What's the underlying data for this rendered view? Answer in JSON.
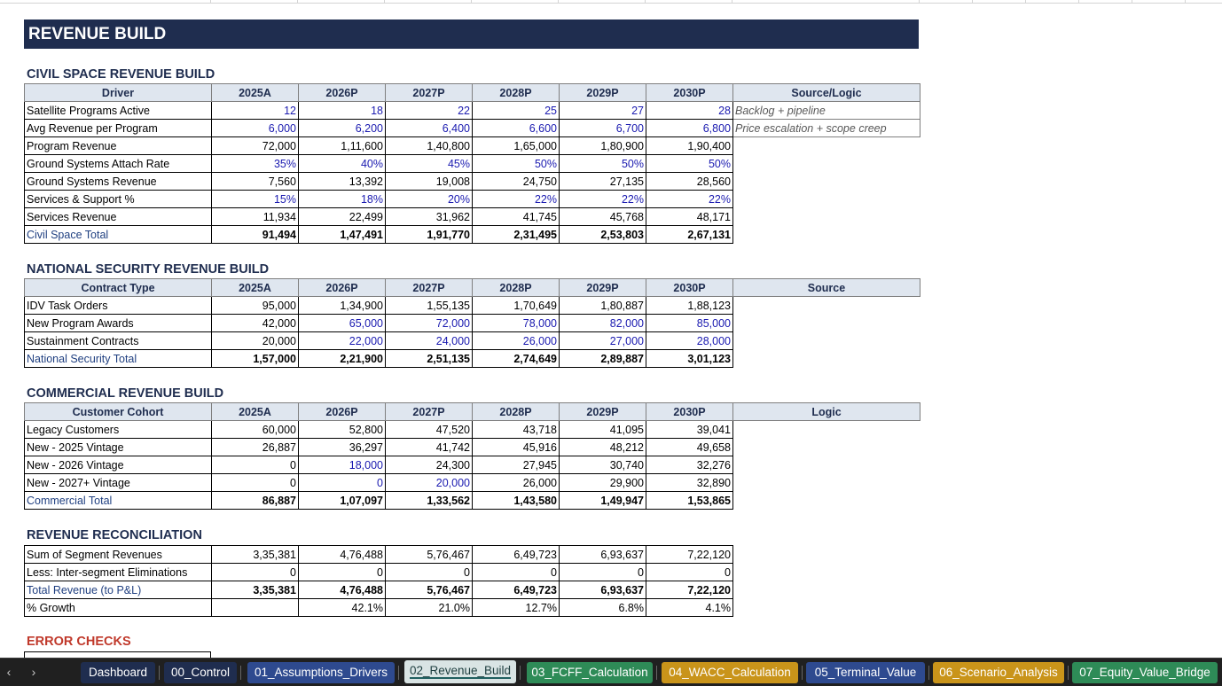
{
  "banner": "REVENUE BUILD",
  "civil": {
    "title": "CIVIL SPACE REVENUE BUILD",
    "headers": [
      "Driver",
      "2025A",
      "2026P",
      "2027P",
      "2028P",
      "2029P",
      "2030P",
      "Source/Logic"
    ],
    "rows": [
      {
        "label": "Satellite Programs Active",
        "values": [
          "12",
          "18",
          "22",
          "25",
          "27",
          "28"
        ],
        "note": "Backlog + pipeline",
        "blue": [
          1,
          1,
          1,
          1,
          1,
          1
        ]
      },
      {
        "label": "Avg Revenue per Program",
        "values": [
          "6,000",
          "6,200",
          "6,400",
          "6,600",
          "6,700",
          "6,800"
        ],
        "note": "Price escalation + scope creep",
        "blue": [
          1,
          1,
          1,
          1,
          1,
          1
        ]
      },
      {
        "label": "Program Revenue",
        "values": [
          "72,000",
          "1,11,600",
          "1,40,800",
          "1,65,000",
          "1,80,900",
          "1,90,400"
        ],
        "blue": [
          0,
          0,
          0,
          0,
          0,
          0
        ]
      },
      {
        "label": "Ground Systems Attach Rate",
        "values": [
          "35%",
          "40%",
          "45%",
          "50%",
          "50%",
          "50%"
        ],
        "blue": [
          1,
          1,
          1,
          1,
          1,
          1
        ]
      },
      {
        "label": "Ground Systems Revenue",
        "values": [
          "7,560",
          "13,392",
          "19,008",
          "24,750",
          "27,135",
          "28,560"
        ],
        "blue": [
          0,
          0,
          0,
          0,
          0,
          0
        ]
      },
      {
        "label": "Services & Support %",
        "values": [
          "15%",
          "18%",
          "20%",
          "22%",
          "22%",
          "22%"
        ],
        "blue": [
          1,
          1,
          1,
          1,
          1,
          1
        ]
      },
      {
        "label": "Services Revenue",
        "values": [
          "11,934",
          "22,499",
          "31,962",
          "41,745",
          "45,768",
          "48,171"
        ],
        "blue": [
          0,
          0,
          0,
          0,
          0,
          0
        ]
      },
      {
        "label": "Civil Space Total",
        "values": [
          "91,494",
          "1,47,491",
          "1,91,770",
          "2,31,495",
          "2,53,803",
          "2,67,131"
        ],
        "total": true
      }
    ]
  },
  "natsec": {
    "title": "NATIONAL SECURITY REVENUE BUILD",
    "headers": [
      "Contract Type",
      "2025A",
      "2026P",
      "2027P",
      "2028P",
      "2029P",
      "2030P",
      "Source"
    ],
    "rows": [
      {
        "label": "IDV Task Orders",
        "values": [
          "95,000",
          "1,34,900",
          "1,55,135",
          "1,70,649",
          "1,80,887",
          "1,88,123"
        ],
        "blue": [
          0,
          0,
          0,
          0,
          0,
          0
        ]
      },
      {
        "label": "New Program Awards",
        "values": [
          "42,000",
          "65,000",
          "72,000",
          "78,000",
          "82,000",
          "85,000"
        ],
        "blue": [
          0,
          1,
          1,
          1,
          1,
          1
        ]
      },
      {
        "label": "Sustainment Contracts",
        "values": [
          "20,000",
          "22,000",
          "24,000",
          "26,000",
          "27,000",
          "28,000"
        ],
        "blue": [
          0,
          1,
          1,
          1,
          1,
          1
        ]
      },
      {
        "label": "National Security Total",
        "values": [
          "1,57,000",
          "2,21,900",
          "2,51,135",
          "2,74,649",
          "2,89,887",
          "3,01,123"
        ],
        "total": true
      }
    ]
  },
  "commercial": {
    "title": "COMMERCIAL REVENUE BUILD",
    "headers": [
      "Customer Cohort",
      "2025A",
      "2026P",
      "2027P",
      "2028P",
      "2029P",
      "2030P",
      "Logic"
    ],
    "rows": [
      {
        "label": "Legacy Customers",
        "values": [
          "60,000",
          "52,800",
          "47,520",
          "43,718",
          "41,095",
          "39,041"
        ],
        "blue": [
          0,
          0,
          0,
          0,
          0,
          0
        ]
      },
      {
        "label": "New - 2025 Vintage",
        "values": [
          "26,887",
          "36,297",
          "41,742",
          "45,916",
          "48,212",
          "49,658"
        ],
        "blue": [
          0,
          0,
          0,
          0,
          0,
          0
        ]
      },
      {
        "label": "New - 2026 Vintage",
        "values": [
          "0",
          "18,000",
          "24,300",
          "27,945",
          "30,740",
          "32,276"
        ],
        "blue": [
          0,
          1,
          0,
          0,
          0,
          0
        ]
      },
      {
        "label": "New - 2027+ Vintage",
        "values": [
          "0",
          "0",
          "20,000",
          "26,000",
          "29,900",
          "32,890"
        ],
        "blue": [
          0,
          1,
          1,
          0,
          0,
          0
        ]
      },
      {
        "label": "Commercial Total",
        "values": [
          "86,887",
          "1,07,097",
          "1,33,562",
          "1,43,580",
          "1,49,947",
          "1,53,865"
        ],
        "total": true
      }
    ]
  },
  "recon": {
    "title": "REVENUE RECONCILIATION",
    "rows": [
      {
        "label": "Sum of Segment Revenues",
        "values": [
          "3,35,381",
          "4,76,488",
          "5,76,467",
          "6,49,723",
          "6,93,637",
          "7,22,120"
        ]
      },
      {
        "label": "Less: Inter-segment Eliminations",
        "values": [
          "0",
          "0",
          "0",
          "0",
          "0",
          "0"
        ]
      },
      {
        "label": "Total Revenue (to P&L)",
        "values": [
          "3,35,381",
          "4,76,488",
          "5,76,467",
          "6,49,723",
          "6,93,637",
          "7,22,120"
        ],
        "total": true
      },
      {
        "label": "% Growth",
        "values": [
          "",
          "42.1%",
          "21.0%",
          "12.7%",
          "6.8%",
          "4.1%"
        ]
      }
    ]
  },
  "errors": {
    "title": "ERROR CHECKS"
  },
  "tabs": [
    {
      "label": "Dashboard",
      "color": "#1f2d4f"
    },
    {
      "label": "00_Control",
      "color": "#1f2d4f"
    },
    {
      "label": "01_Assumptions_Drivers",
      "color": "#2e4a8f"
    },
    {
      "label": "02_Revenue_Build",
      "color": "#d9e4e4",
      "active": true
    },
    {
      "label": "03_FCFF_Calculation",
      "color": "#2e8b57"
    },
    {
      "label": "04_WACC_Calculation",
      "color": "#c9941a"
    },
    {
      "label": "05_Terminal_Value",
      "color": "#2e4a8f"
    },
    {
      "label": "06_Scenario_Analysis",
      "color": "#c9941a"
    },
    {
      "label": "07_Equity_Value_Bridge",
      "color": "#2e8b57"
    }
  ],
  "nav": {
    "prev": "‹",
    "next": "›"
  }
}
